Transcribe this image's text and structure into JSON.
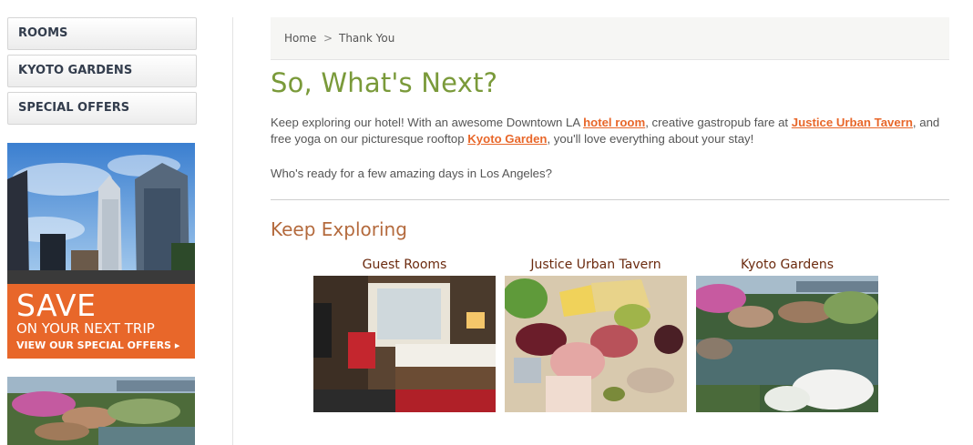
{
  "sidebar": {
    "nav": [
      "ROOMS",
      "KYOTO GARDENS",
      "SPECIAL OFFERS"
    ],
    "promo": {
      "headline": "SAVE",
      "subline": "ON YOUR NEXT TRIP",
      "cta": "VIEW OUR SPECIAL OFFERS",
      "cta_icon": "caret-right-icon",
      "accent": "#e8672a"
    }
  },
  "breadcrumb": {
    "home": "Home",
    "separator": ">",
    "current": "Thank You"
  },
  "main": {
    "title": "So, What's Next?",
    "intro": {
      "t1": "Keep exploring our hotel! With an awesome Downtown LA ",
      "link1": "hotel room",
      "t2": ", creative gastropub fare at ",
      "link2": "Justice Urban Tavern",
      "t3": ", and free yoga on our picturesque rooftop ",
      "link3": "Kyoto Garden",
      "t4": ", you'll love everything about your stay!"
    },
    "question": "Who's ready for a few amazing days in Los Angeles?",
    "explore_title": "Keep Exploring",
    "cards": [
      {
        "title": "Guest Rooms"
      },
      {
        "title": "Justice Urban Tavern"
      },
      {
        "title": "Kyoto Gardens"
      }
    ]
  },
  "colors": {
    "title_green": "#7a9a3a",
    "link_orange": "#e8672a",
    "section_brown": "#b46a3d",
    "card_title": "#6b2a0e"
  }
}
